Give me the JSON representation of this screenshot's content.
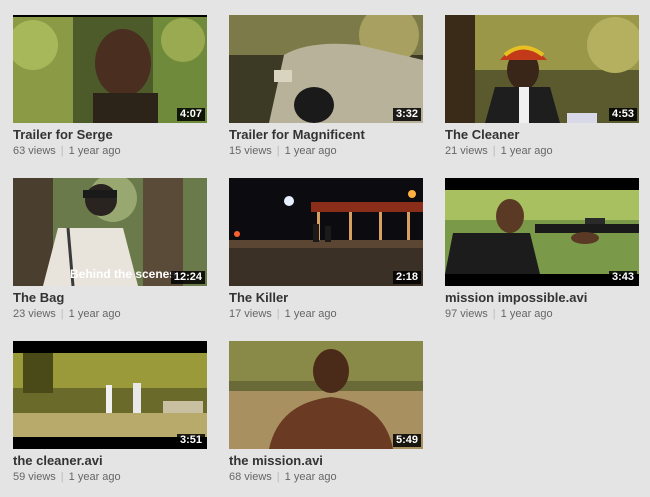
{
  "videos": [
    {
      "title": "Trailer for Serge",
      "duration": "4:07",
      "views": "63 views",
      "age": "1 year ago"
    },
    {
      "title": "Trailer for Magnificent",
      "duration": "3:32",
      "views": "15 views",
      "age": "1 year ago"
    },
    {
      "title": "The Cleaner",
      "duration": "4:53",
      "views": "21 views",
      "age": "1 year ago"
    },
    {
      "title": "The Bag",
      "duration": "12:24",
      "views": "23 views",
      "age": "1 year ago",
      "overlay_text": "Behind the scenes"
    },
    {
      "title": "The Killer",
      "duration": "2:18",
      "views": "17 views",
      "age": "1 year ago"
    },
    {
      "title": "mission impossible.avi",
      "duration": "3:43",
      "views": "97 views",
      "age": "1 year ago"
    },
    {
      "title": "the cleaner.avi",
      "duration": "3:51",
      "views": "59 views",
      "age": "1 year ago"
    },
    {
      "title": "the mission.avi",
      "duration": "5:49",
      "views": "68 views",
      "age": "1 year ago"
    }
  ]
}
